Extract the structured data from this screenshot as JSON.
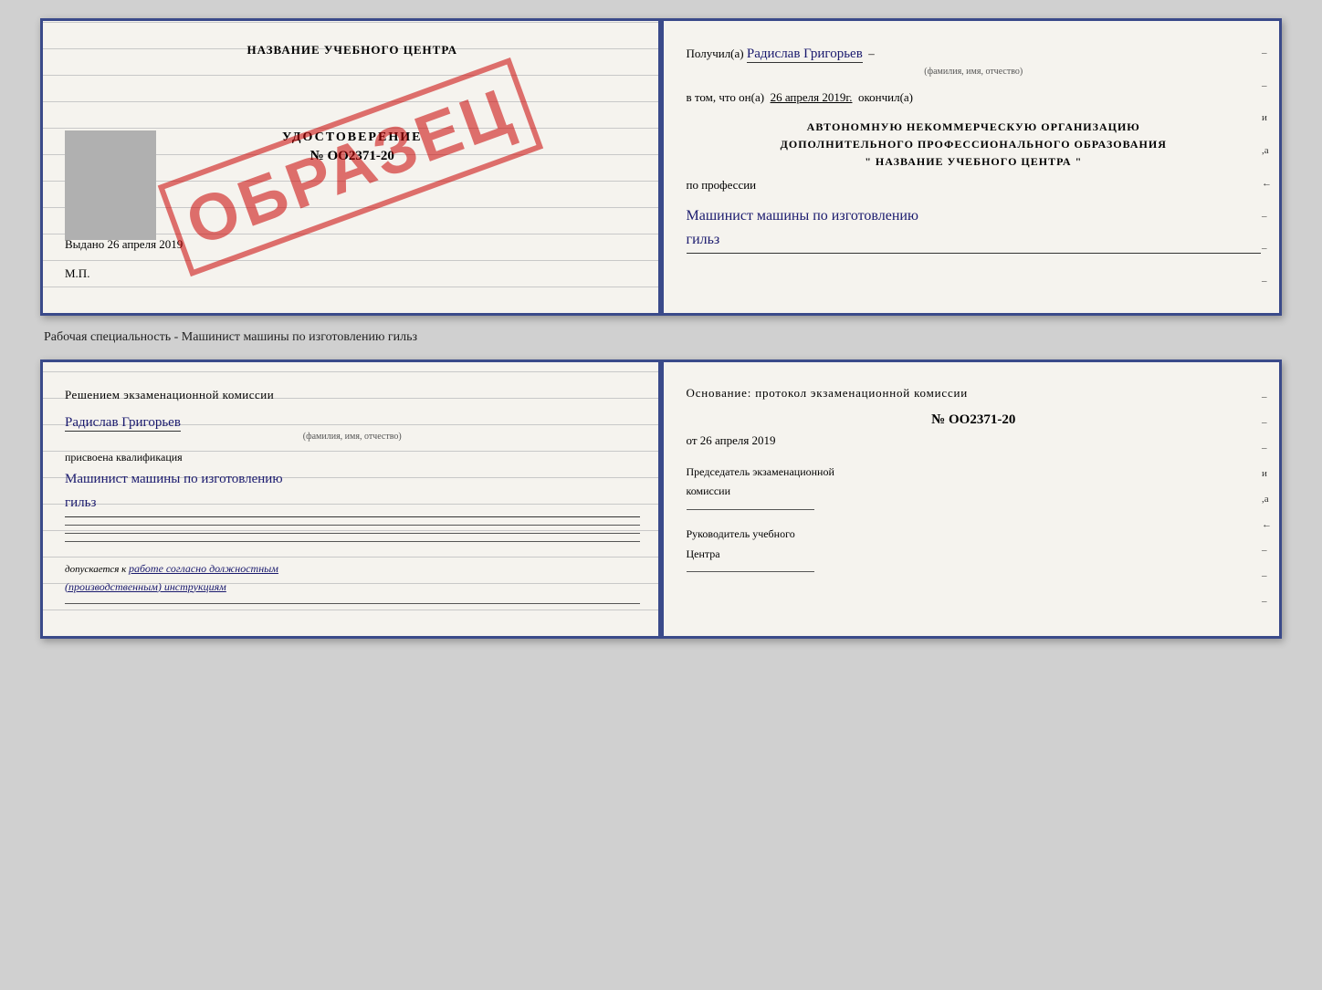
{
  "top_cert": {
    "left": {
      "center_name": "НАЗВАНИЕ УЧЕБНОГО ЦЕНТРА",
      "stamp_text": "ОБРАЗЕЦ",
      "udost_label": "УДОСТОВЕРЕНИЕ",
      "udost_number": "№ OO2371-20",
      "vydano_label": "Выдано",
      "vydano_date": "26 апреля 2019",
      "mp_label": "М.П."
    },
    "right": {
      "poluchil_label": "Получил(а)",
      "poluchil_name": "Радислав Григорьев",
      "fio_small": "(фамилия, имя, отчество)",
      "vtom_label": "в том, что он(а)",
      "vtom_date": "26 апреля 2019г.",
      "okonchil_label": "окончил(а)",
      "org_line1": "АВТОНОМНУЮ НЕКОММЕРЧЕСКУЮ ОРГАНИЗАЦИЮ",
      "org_line2": "ДОПОЛНИТЕЛЬНОГО ПРОФЕССИОНАЛЬНОГО ОБРАЗОВАНИЯ",
      "org_quotes_open": "\"",
      "org_center_name": "НАЗВАНИЕ УЧЕБНОГО ЦЕНТРА",
      "org_quotes_close": "\"",
      "po_professii": "по профессии",
      "profession_line1": "Машинист машины по изготовлению",
      "profession_line2": "гильз",
      "side_marks": [
        "-",
        "-",
        "-",
        "и",
        ",а",
        "←",
        "-",
        "-",
        "-"
      ]
    }
  },
  "subtitle": "Рабочая специальность - Машинист машины по изготовлению гильз",
  "bottom_cert": {
    "left": {
      "resheniyem_label": "Решением  экзаменационной  комиссии",
      "name_handwritten": "Радислав Григорьев",
      "fio_small": "(фамилия, имя, отчество)",
      "prisvoena_label": "присвоена квалификация",
      "kvali_line1": "Машинист машины по изготовлению",
      "kvali_line2": "гильз",
      "dopusk_label": "допускается к",
      "dopusk_text_line1": "работе согласно должностным",
      "dopusk_text_line2": "(производственным) инструкциям"
    },
    "right": {
      "osnov_label": "Основание: протокол экзаменационной  комиссии",
      "number_label": "№  OO2371-20",
      "ot_label": "от",
      "ot_date": "26 апреля 2019",
      "predsedatel_label": "Председатель экзаменационной",
      "komissii_label": "комиссии",
      "rukovoditel_label": "Руководитель учебного",
      "tsentra_label": "Центра",
      "side_marks": [
        "-",
        "-",
        "-",
        "и",
        ",а",
        "←",
        "-",
        "-",
        "-"
      ]
    }
  }
}
